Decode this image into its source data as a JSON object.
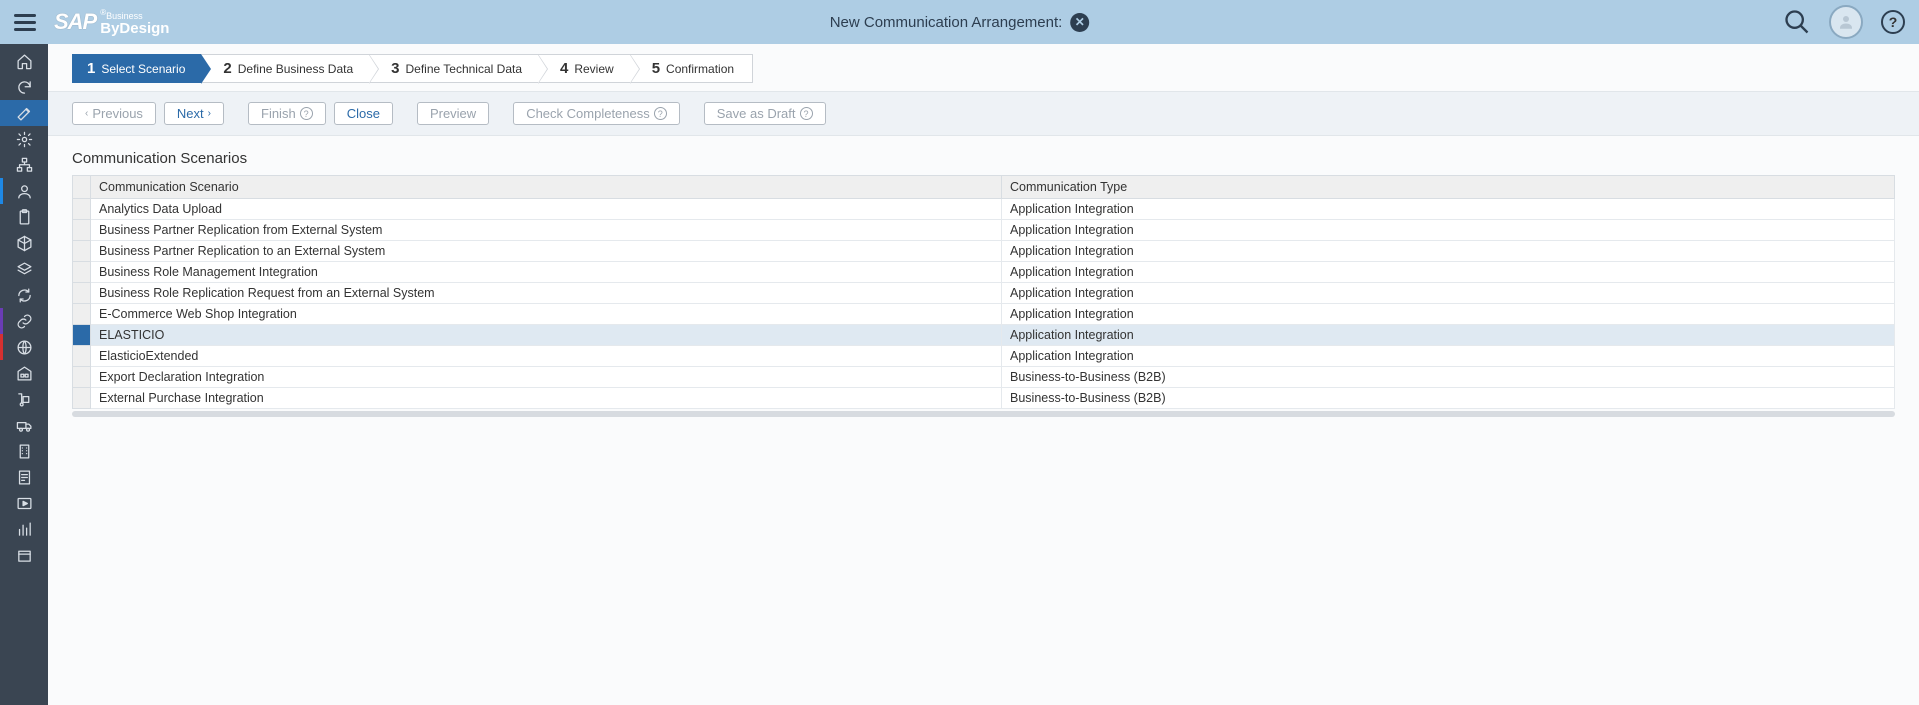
{
  "header": {
    "title": "New Communication Arrangement:",
    "logo_business": "Business",
    "logo_bydesign": "ByDesign",
    "logo_sap": "SAP"
  },
  "steps": [
    {
      "num": "1",
      "label": "Select Scenario",
      "active": true
    },
    {
      "num": "2",
      "label": "Define Business Data",
      "active": false
    },
    {
      "num": "3",
      "label": "Define Technical Data",
      "active": false
    },
    {
      "num": "4",
      "label": "Review",
      "active": false
    },
    {
      "num": "5",
      "label": "Confirmation",
      "active": false
    }
  ],
  "toolbar": {
    "previous": "Previous",
    "next": "Next",
    "finish": "Finish",
    "close": "Close",
    "preview": "Preview",
    "check": "Check Completeness",
    "draft": "Save as Draft"
  },
  "section_title": "Communication Scenarios",
  "columns": {
    "scenario": "Communication Scenario",
    "type": "Communication Type"
  },
  "rows": [
    {
      "scenario": "Analytics Data Upload",
      "type": "Application Integration",
      "selected": false
    },
    {
      "scenario": "Business Partner Replication from External System",
      "type": "Application Integration",
      "selected": false
    },
    {
      "scenario": "Business Partner Replication to an External System",
      "type": "Application Integration",
      "selected": false
    },
    {
      "scenario": "Business Role Management Integration",
      "type": "Application Integration",
      "selected": false
    },
    {
      "scenario": "Business Role Replication Request from an External System",
      "type": "Application Integration",
      "selected": false
    },
    {
      "scenario": "E-Commerce Web Shop Integration",
      "type": "Application Integration",
      "selected": false
    },
    {
      "scenario": "ELASTICIO",
      "type": "Application Integration",
      "selected": true
    },
    {
      "scenario": "ElasticioExtended",
      "type": "Application Integration",
      "selected": false
    },
    {
      "scenario": "Export Declaration Integration",
      "type": "Business-to-Business (B2B)",
      "selected": false
    },
    {
      "scenario": "External Purchase Integration",
      "type": "Business-to-Business (B2B)",
      "selected": false
    }
  ],
  "rail": [
    {
      "name": "home-icon",
      "accent": ""
    },
    {
      "name": "refresh-icon",
      "accent": ""
    },
    {
      "name": "edit-icon",
      "accent": "",
      "selected": true
    },
    {
      "name": "gears-icon",
      "accent": ""
    },
    {
      "name": "orgchart-icon",
      "accent": ""
    },
    {
      "name": "person-icon",
      "accent": "blue"
    },
    {
      "name": "clipboard-icon",
      "accent": ""
    },
    {
      "name": "package-icon",
      "accent": ""
    },
    {
      "name": "layers-icon",
      "accent": ""
    },
    {
      "name": "sync-icon",
      "accent": ""
    },
    {
      "name": "link-icon",
      "accent": "purple"
    },
    {
      "name": "globe-icon",
      "accent": "red"
    },
    {
      "name": "warehouse-icon",
      "accent": ""
    },
    {
      "name": "dolly-icon",
      "accent": ""
    },
    {
      "name": "truck-icon",
      "accent": ""
    },
    {
      "name": "building-icon",
      "accent": ""
    },
    {
      "name": "report-icon",
      "accent": ""
    },
    {
      "name": "play-icon",
      "accent": ""
    },
    {
      "name": "analytics-icon",
      "accent": ""
    },
    {
      "name": "box-icon",
      "accent": ""
    }
  ]
}
